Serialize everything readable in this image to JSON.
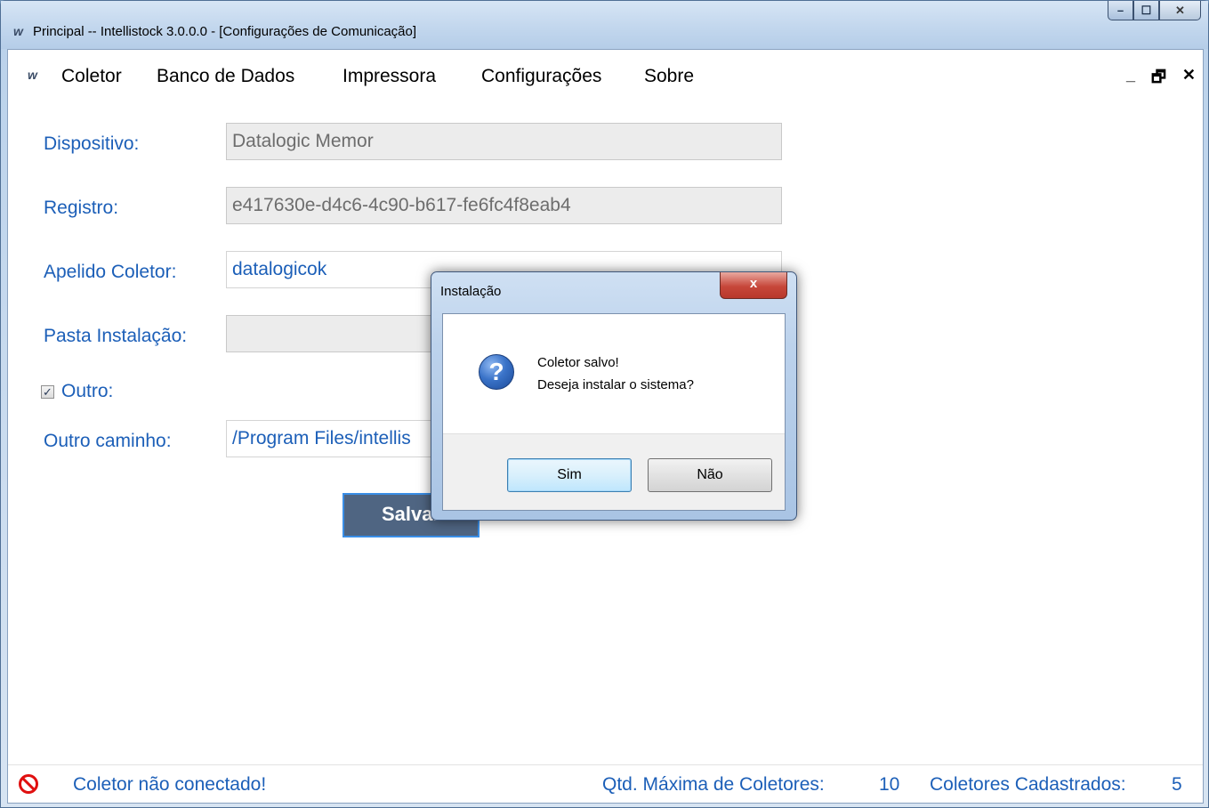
{
  "window": {
    "title": "Principal -- Intellistock 3.0.0.0 - [Configurações de Comunicação]",
    "logo": "w",
    "buttons": {
      "minimize": "–",
      "maximize": "☐",
      "close": "✕"
    }
  },
  "menu": {
    "logo": "w",
    "items": [
      "Coletor",
      "Banco de Dados",
      "Impressora",
      "Configurações",
      "Sobre"
    ],
    "mdi": {
      "minimize": "_",
      "restore": "🗗",
      "close": "✕"
    }
  },
  "form": {
    "dispositivo_label": "Dispositivo:",
    "dispositivo_value": "Datalogic Memor",
    "registro_label": "Registro:",
    "registro_value": "e417630e-d4c6-4c90-b617-fe6fc4f8eab4",
    "apelido_label": "Apelido Coletor:",
    "apelido_value": "datalogicok",
    "pasta_label": "Pasta Instalação:",
    "pasta_value": "",
    "outro_checked": true,
    "outro_check_glyph": "✓",
    "outro_label": "Outro:",
    "outro_caminho_label": "Outro caminho:",
    "outro_caminho_value": "/Program Files/intellis",
    "save_label": "Salvar"
  },
  "status": {
    "icon": "no-entry-icon",
    "message": "Coletor não conectado!",
    "max_label": "Qtd. Máxima de Coletores:",
    "max_value": "10",
    "registered_label": "Coletores Cadastrados:",
    "registered_value": "5"
  },
  "dialog": {
    "title": "Instalação",
    "close": "x",
    "icon": "question-icon",
    "icon_glyph": "?",
    "line1": "Coletor salvo!",
    "line2": "Deseja instalar o sistema?",
    "yes_label": "Sim",
    "no_label": "Não"
  }
}
